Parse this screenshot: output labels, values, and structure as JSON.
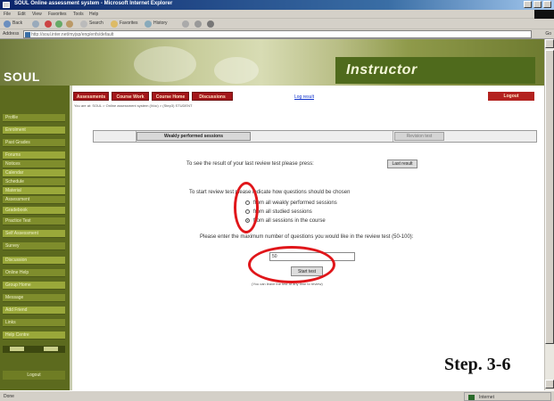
{
  "window": {
    "title": "SOUL Online assessment system - Microsoft Internet Explorer"
  },
  "menubar": {
    "items": [
      "File",
      "Edit",
      "View",
      "Favorites",
      "Tools",
      "Help"
    ]
  },
  "toolbar": {
    "back_label": "Back",
    "search_label": "Search",
    "favorites_label": "Favorites",
    "history_label": "History"
  },
  "addressbar": {
    "label": "Address",
    "url": "http://soul.inter.net/myjsp/eng/enfs/default",
    "go_label": "Go"
  },
  "banner": {
    "logo_text": "SOUL",
    "brand_text": "Instructor"
  },
  "sidebar": {
    "items": [
      "Profile",
      "Enrolment",
      "Past Grades",
      "Forums",
      "Notices",
      "Calendar",
      "Schedule",
      "Material",
      "Assessment",
      "Gradebook",
      "Practice Test",
      "Self Assessment",
      "Survey",
      "Discussion",
      "Online Help",
      "Group Home",
      "Message",
      "Add Friend",
      "Links",
      "Help Centre"
    ],
    "logout_label": "Logout"
  },
  "nav": {
    "tabs": [
      "Assessments",
      "Course Work",
      "Course Home",
      "Discussions"
    ],
    "link_label": "Log result",
    "logout_label": "Logout",
    "breadcrumb": "You are at: SOUL > Online assessment system (iVoc) > (Step3) STUDENT"
  },
  "function_bar": {
    "weakly_button_label": "Weakly performed sessions",
    "disabled_button_label": "Revision test"
  },
  "content": {
    "result_prompt": "To see the result of your last review test please press:",
    "result_button_label": "Last result",
    "choose_prompt": "To start review test please indicate how questions should be chosen",
    "options": [
      {
        "label": "from all weakly performed sessions",
        "selected": false
      },
      {
        "label": "from all studied sessions",
        "selected": false
      },
      {
        "label": "from all sessions in the course",
        "selected": true
      }
    ],
    "max_prompt": "Please enter the maximum number of questions you would like in the review test (50-100):",
    "max_value": "50",
    "start_button_label": "Start test",
    "note": "(You can leave the test at any time to review)"
  },
  "annotation": {
    "step_label": "Step. 3-6",
    "highlight_color": "#e0161a"
  },
  "statusbar": {
    "status_text": "Done",
    "zone_text": "Internet"
  }
}
